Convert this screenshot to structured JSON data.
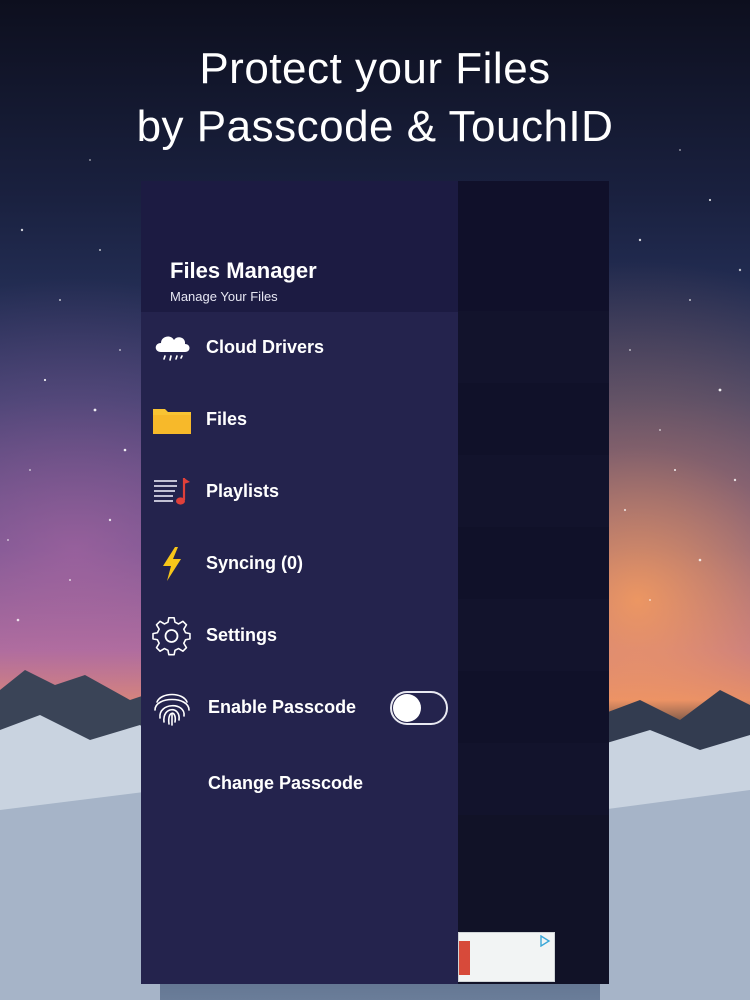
{
  "headline": {
    "line1": "Protect your Files",
    "line2": "by Passcode & TouchID"
  },
  "drawer": {
    "title": "Files Manager",
    "subtitle": "Manage Your Files",
    "items": [
      {
        "label": "Cloud Drivers",
        "icon": "cloud-rain-icon"
      },
      {
        "label": "Files",
        "icon": "folder-icon"
      },
      {
        "label": "Playlists",
        "icon": "playlist-music-icon"
      },
      {
        "label": "Syncing (0)",
        "icon": "lightning-icon"
      },
      {
        "label": "Settings",
        "icon": "gear-icon"
      },
      {
        "label": "Enable Passcode",
        "icon": "fingerprint-icon"
      },
      {
        "label": "Change Passcode"
      }
    ],
    "passcode_enabled": false
  },
  "colors": {
    "drawer_bg": "#24234d",
    "header_bg": "#1c1b42",
    "folder": "#f9c433",
    "lightning": "#f7c619",
    "music_note": "#e0403a"
  }
}
